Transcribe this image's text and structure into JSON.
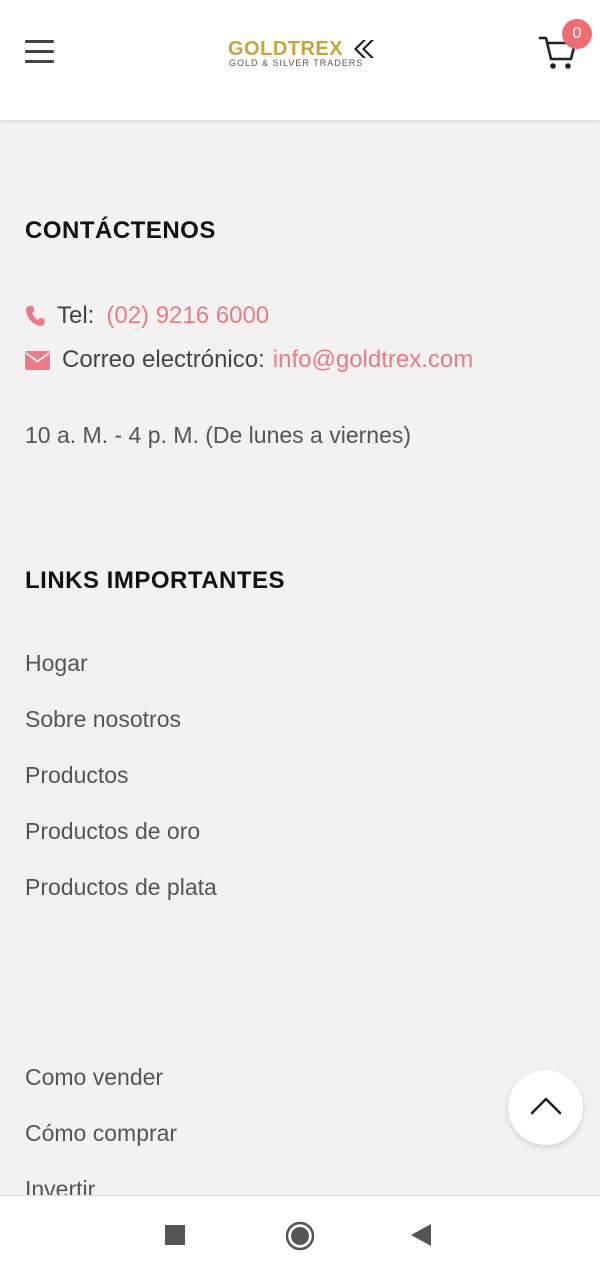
{
  "header": {
    "logo_main": "GOLDTREX",
    "logo_sub": "GOLD & SILVER TRADERS",
    "cart_count": "0"
  },
  "contact": {
    "title": "CONTÁCTENOS",
    "tel_label": "Tel:",
    "tel_value": "(02) 9216 6000",
    "email_label": "Correo electrónico:",
    "email_value": "info@goldtrex.com",
    "hours": "10 a. M. - 4 p. M. (De lunes a viernes)"
  },
  "links": {
    "title": "LINKS IMPORTANTES",
    "items": [
      {
        "label": "Hogar"
      },
      {
        "label": "Sobre nosotros"
      },
      {
        "label": "Productos"
      },
      {
        "label": "Productos de oro"
      },
      {
        "label": "Productos de plata"
      }
    ],
    "more_items": [
      {
        "label": "Como vender"
      },
      {
        "label": "Cómo comprar"
      },
      {
        "label": "Invertir"
      }
    ]
  },
  "icons": {
    "menu": "hamburger-menu-icon",
    "cart": "cart-icon",
    "phone": "phone-icon",
    "email": "envelope-icon",
    "scroll_top": "chevron-up-icon",
    "nav_recents": "square-icon",
    "nav_home": "circle-icon",
    "nav_back": "triangle-back-icon"
  },
  "colors": {
    "accent_pink": "#ef7a82",
    "badge": "#ef6c72",
    "gold": "#c9a43a",
    "background": "#f2f2f2"
  }
}
